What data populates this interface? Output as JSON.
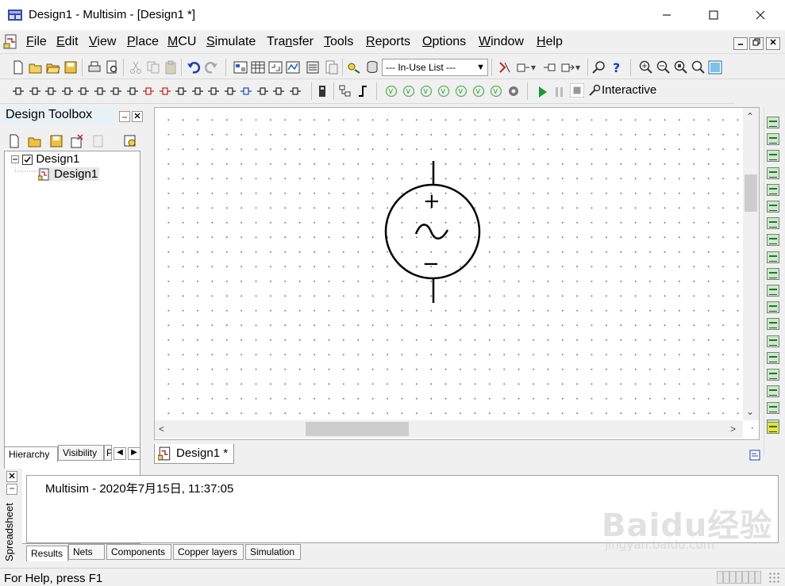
{
  "window": {
    "title": "Design1 - Multisim - [Design1 *]"
  },
  "menu": [
    {
      "label": "File",
      "u": "F",
      "rest": "ile"
    },
    {
      "label": "Edit",
      "u": "E",
      "rest": "dit"
    },
    {
      "label": "View",
      "u": "V",
      "rest": "iew"
    },
    {
      "label": "Place",
      "u": "P",
      "rest": "lace"
    },
    {
      "label": "MCU",
      "u": "M",
      "rest": "CU"
    },
    {
      "label": "Simulate",
      "u": "S",
      "rest": "imulate"
    },
    {
      "label": "Transfer",
      "pre": "Tra",
      "u": "n",
      "rest": "sfer"
    },
    {
      "label": "Tools",
      "u": "T",
      "rest": "ools"
    },
    {
      "label": "Reports",
      "u": "R",
      "rest": "eports"
    },
    {
      "label": "Options",
      "u": "O",
      "rest": "ptions"
    },
    {
      "label": "Window",
      "u": "W",
      "rest": "indow"
    },
    {
      "label": "Help",
      "u": "H",
      "rest": "elp"
    }
  ],
  "toolbar": {
    "in_use_list": "--- In-Use List ---",
    "interactive_label": "Interactive"
  },
  "toolbox": {
    "title": "Design Toolbox",
    "tree": [
      {
        "label": "Design1"
      },
      {
        "label": "Design1"
      }
    ],
    "tabs": [
      "Hierarchy",
      "Visibility",
      "P"
    ]
  },
  "canvas": {
    "doc_tab": "Design1 *",
    "component": {
      "name": "ac-voltage-source",
      "plus": "+",
      "minus": "−"
    }
  },
  "spreadsheet": {
    "label": "Spreadsheet",
    "results_text": "Multisim  -  2020年7月15日, 11:37:05",
    "tabs": [
      "Results",
      "Nets",
      "Components",
      "Copper layers",
      "Simulation"
    ]
  },
  "status": {
    "help_text": "For Help, press F1"
  },
  "watermark": {
    "text": "Baidu经验",
    "url": "jingyan.baidu.com"
  }
}
